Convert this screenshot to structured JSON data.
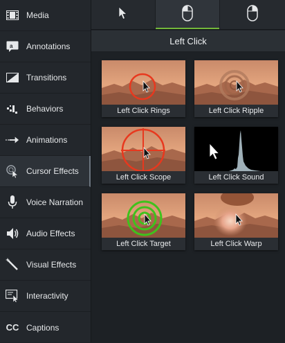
{
  "sidebar": {
    "items": [
      {
        "label": "Media",
        "icon": "film-strip-icon",
        "active": false
      },
      {
        "label": "Annotations",
        "icon": "annotation-icon",
        "active": false
      },
      {
        "label": "Transitions",
        "icon": "transition-icon",
        "active": false
      },
      {
        "label": "Behaviors",
        "icon": "behavior-icon",
        "active": false
      },
      {
        "label": "Animations",
        "icon": "animation-arrow-icon",
        "active": false
      },
      {
        "label": "Cursor Effects",
        "icon": "cursor-effect-icon",
        "active": true
      },
      {
        "label": "Voice Narration",
        "icon": "microphone-icon",
        "active": false
      },
      {
        "label": "Audio Effects",
        "icon": "speaker-icon",
        "active": false
      },
      {
        "label": "Visual Effects",
        "icon": "magic-wand-icon",
        "active": false
      },
      {
        "label": "Interactivity",
        "icon": "interactive-icon",
        "active": false
      },
      {
        "label": "Captions",
        "icon": "cc-icon",
        "active": false
      }
    ],
    "captions_glyph": "CC"
  },
  "tabs": [
    {
      "name": "cursor-tab",
      "icon": "arrow-cursor-icon",
      "selected": false
    },
    {
      "name": "left-click-tab",
      "icon": "mouse-left-click-icon",
      "selected": true
    },
    {
      "name": "right-click-tab",
      "icon": "mouse-right-click-icon",
      "selected": false
    }
  ],
  "section_title": "Left Click",
  "effects": [
    {
      "label": "Left Click Rings",
      "style": "rings"
    },
    {
      "label": "Left Click Ripple",
      "style": "ripple"
    },
    {
      "label": "Left Click Scope",
      "style": "scope"
    },
    {
      "label": "Left Click Sound",
      "style": "sound"
    },
    {
      "label": "Left Click Target",
      "style": "target"
    },
    {
      "label": "Left Click Warp",
      "style": "warp"
    }
  ],
  "colors": {
    "accent_green": "#74b83a",
    "effect_red": "#e8381e",
    "target_green": "#3fc21c"
  }
}
